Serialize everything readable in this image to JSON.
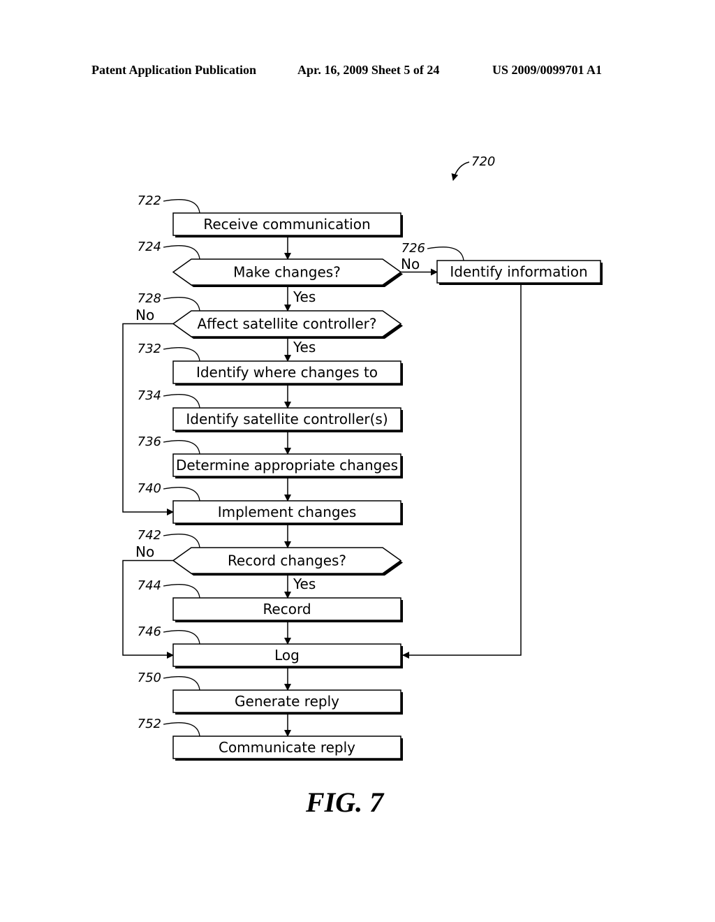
{
  "header": {
    "left": "Patent Application Publication",
    "middle": "Apr. 16, 2009  Sheet 5 of 24",
    "right": "US 2009/0099701 A1"
  },
  "figure_ref": "720",
  "figure_label": "FIG. 7",
  "nodes": [
    {
      "id": "722",
      "type": "process",
      "text": "Receive communication"
    },
    {
      "id": "724",
      "type": "decision",
      "text": "Make changes?"
    },
    {
      "id": "726",
      "type": "process",
      "text": "Identify information"
    },
    {
      "id": "728",
      "type": "decision",
      "text": "Affect satellite controller?"
    },
    {
      "id": "732",
      "type": "process",
      "text": "Identify where changes to"
    },
    {
      "id": "734",
      "type": "process",
      "text": "Identify satellite controller(s)"
    },
    {
      "id": "736",
      "type": "process",
      "text": "Determine appropriate changes"
    },
    {
      "id": "740",
      "type": "process",
      "text": "Implement changes"
    },
    {
      "id": "742",
      "type": "decision",
      "text": "Record changes?"
    },
    {
      "id": "744",
      "type": "process",
      "text": "Record"
    },
    {
      "id": "746",
      "type": "process",
      "text": "Log"
    },
    {
      "id": "750",
      "type": "process",
      "text": "Generate reply"
    },
    {
      "id": "752",
      "type": "process",
      "text": "Communicate reply"
    }
  ],
  "edges": [
    {
      "from": "722",
      "to": "724",
      "label": ""
    },
    {
      "from": "724",
      "to": "726",
      "label": "No"
    },
    {
      "from": "724",
      "to": "728",
      "label": "Yes"
    },
    {
      "from": "728",
      "to": "740",
      "label": "No"
    },
    {
      "from": "728",
      "to": "732",
      "label": "Yes"
    },
    {
      "from": "732",
      "to": "734",
      "label": ""
    },
    {
      "from": "734",
      "to": "736",
      "label": ""
    },
    {
      "from": "736",
      "to": "740",
      "label": ""
    },
    {
      "from": "740",
      "to": "742",
      "label": ""
    },
    {
      "from": "742",
      "to": "746",
      "label": "No"
    },
    {
      "from": "742",
      "to": "744",
      "label": "Yes"
    },
    {
      "from": "744",
      "to": "746",
      "label": ""
    },
    {
      "from": "726",
      "to": "746",
      "label": ""
    },
    {
      "from": "746",
      "to": "750",
      "label": ""
    },
    {
      "from": "750",
      "to": "752",
      "label": ""
    }
  ]
}
